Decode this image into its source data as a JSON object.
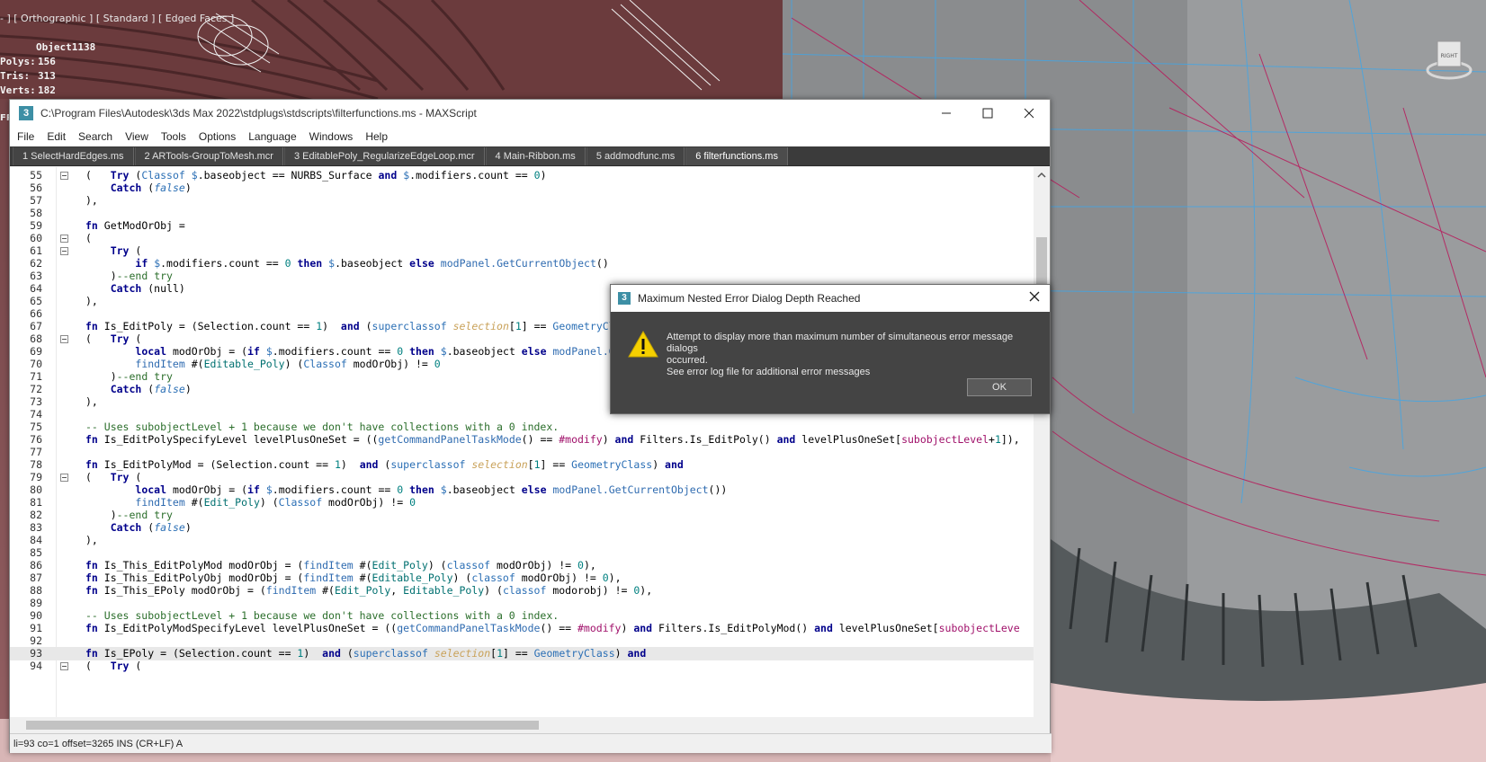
{
  "viewport": {
    "label": "- ] [ Orthographic ] [ Standard ] [ Edged Faces ]",
    "object_name": "Object1138",
    "stats": [
      {
        "label": "Polys:",
        "value": "156"
      },
      {
        "label": "Tris:",
        "value": "313"
      },
      {
        "label": "Verts:",
        "value": "182"
      }
    ],
    "side_text": "FP",
    "viewcube_label": "RIGHT"
  },
  "editor": {
    "title": "C:\\Program Files\\Autodesk\\3ds Max 2022\\stdplugs\\stdscripts\\filterfunctions.ms - MAXScript",
    "app_icon": "3",
    "menu": [
      "File",
      "Edit",
      "Search",
      "View",
      "Tools",
      "Options",
      "Language",
      "Windows",
      "Help"
    ],
    "tabs": [
      "1 SelectHardEdges.ms",
      "2 ARTools-GroupToMesh.mcr",
      "3 EditablePoly_RegularizeEdgeLoop.mcr",
      "4 Main-Ribbon.ms",
      "5 addmodfunc.ms",
      "6 filterfunctions.ms"
    ],
    "active_tab": 5,
    "line_numbers": [
      "55",
      "56",
      "57",
      "58",
      "59",
      "60",
      "61",
      "62",
      "63",
      "64",
      "65",
      "66",
      "67",
      "68",
      "69",
      "70",
      "71",
      "72",
      "73",
      "74",
      "75",
      "76",
      "77",
      "78",
      "79",
      "80",
      "81",
      "82",
      "83",
      "84",
      "85",
      "86",
      "87",
      "88",
      "89",
      "90",
      "91",
      "92",
      "93",
      "94"
    ],
    "status": "li=93 co=1 offset=3265 INS (CR+LF) A"
  },
  "dialog": {
    "title": "Maximum Nested Error Dialog Depth Reached",
    "message_line1": "Attempt to display more than maximum number of simultaneous error message dialogs",
    "message_line2": "occurred.",
    "message_line3": "See error log file for additional error messages",
    "ok_label": "OK",
    "app_icon": "3"
  }
}
